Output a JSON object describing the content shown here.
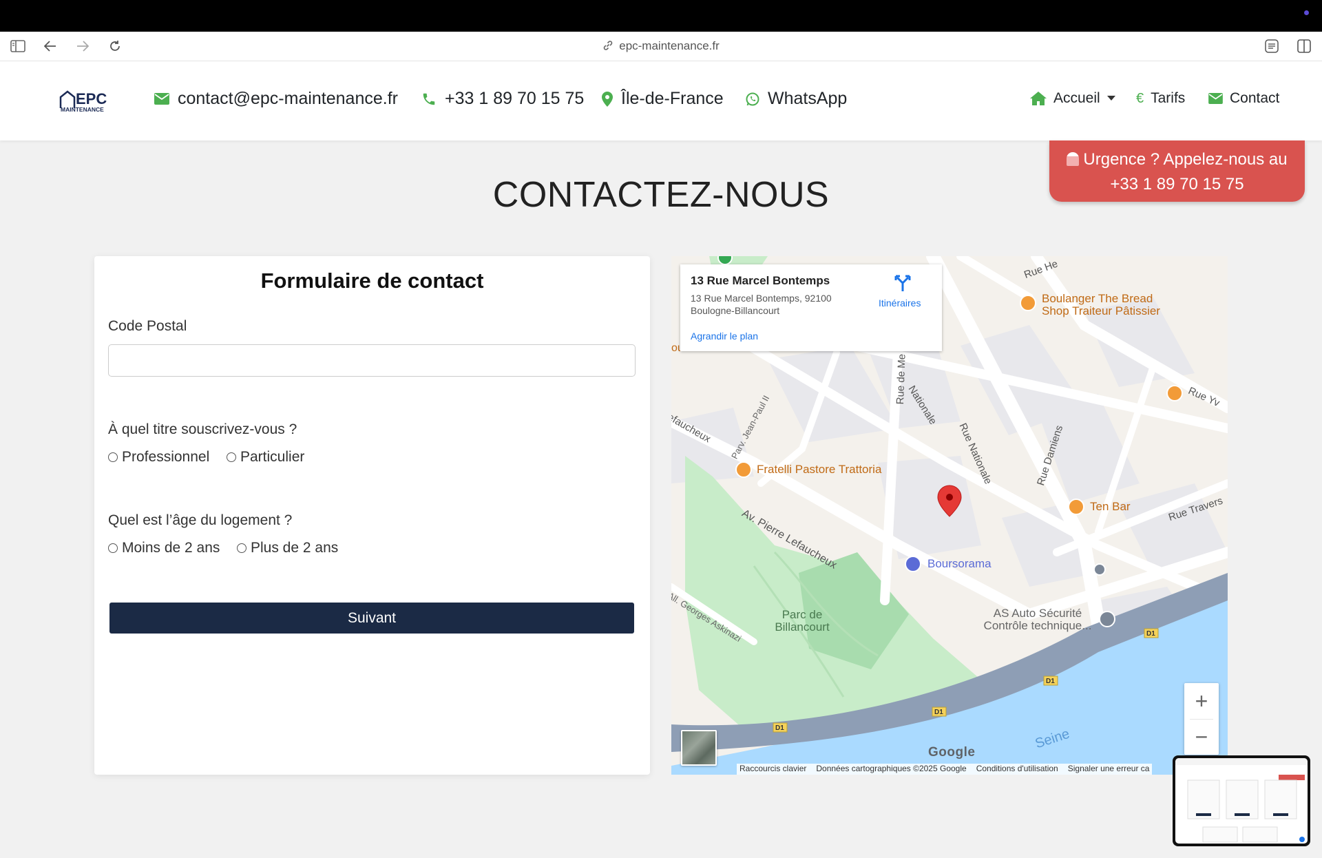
{
  "browser": {
    "url": "epc-maintenance.fr",
    "icons": [
      "sidebar-icon",
      "back-icon",
      "forward-icon",
      "reload-icon",
      "link-icon",
      "reader-icon",
      "split-view-icon"
    ]
  },
  "header": {
    "logo_text_top": "EPC",
    "logo_text_bottom": "MAINTENANCE",
    "email": "contact@epc-maintenance.fr",
    "phone": "+33 1 89 70 15 75",
    "region": "Île-de-France",
    "whatsapp": "WhatsApp",
    "nav": {
      "home": "Accueil",
      "pricing": "Tarifs",
      "contact": "Contact"
    },
    "accent": "#4caf50"
  },
  "urgence": {
    "line1": "Urgence ? Appelez-nous au",
    "line2": "+33 1 89 70 15 75",
    "color": "#d9534f"
  },
  "page_title": "CONTACTEZ-NOUS",
  "form": {
    "title": "Formulaire de contact",
    "postal_label": "Code Postal",
    "postal_value": "",
    "q1": "À quel titre souscrivez-vous ?",
    "q1_options": [
      "Professionnel",
      "Particulier"
    ],
    "q2": "Quel est l’âge du logement ?",
    "q2_options": [
      "Moins de 2 ans",
      "Plus de 2 ans"
    ],
    "submit": "Suivant",
    "button_color": "#1b2a45"
  },
  "map": {
    "place_name": "13 Rue Marcel Bontemps",
    "place_address": "13 Rue Marcel Bontemps, 92100 Boulogne-Billancourt",
    "directions": "Itinéraires",
    "enlarge": "Agrandir le plan",
    "labels": {
      "boulanger": "Boulanger The Bread Shop Traiteur Pâtissier",
      "fratelli": "Fratelli Pastore Trattoria",
      "tenbar": "Ten Bar",
      "boursorama": "Boursorama",
      "as_auto": "AS Auto Sécurité Contrôle technique...",
      "parc": "Parc de Billancourt",
      "seine": "Seine",
      "rue_nationale": "Rue Nationale",
      "rue_nationale_top": "Nationale",
      "rue_damiens": "Rue Damiens",
      "av_pierre": "Av. Pierre Lefaucheux",
      "lefaucheux_left": "efaucheux",
      "parv_jp": "Parv. Jean-Paul II",
      "all_georges": "All. Georges Askinazi",
      "rue_traversiere": "Rue Travers",
      "rue_yv": "Rue Yv",
      "rue_me": "Rue de Me",
      "rue_he": "Rue He",
      "d1": "D1",
      "ourt": "ourt"
    },
    "footer": [
      "Raccourcis clavier",
      "Données cartographiques ©2025 Google",
      "Conditions d'utilisation",
      "Signaler une erreur ca"
    ],
    "google": "Google",
    "zoom_in": "+",
    "zoom_out": "−"
  }
}
